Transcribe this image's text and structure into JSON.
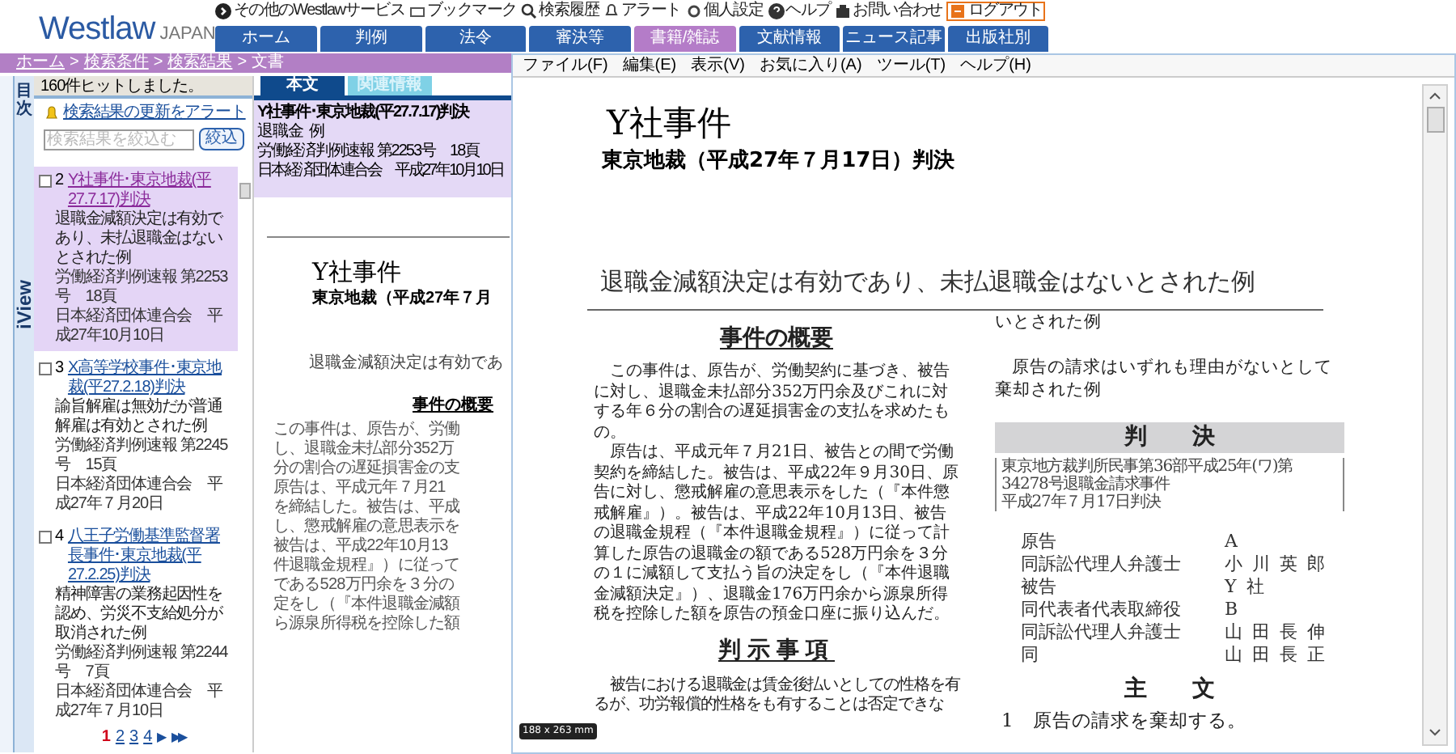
{
  "header": {
    "logo": "Westlaw",
    "logo_suffix": "JAPAN",
    "top_links": [
      {
        "label": "その他のWestlawサービス"
      },
      {
        "label": "ブックマーク"
      },
      {
        "label": "検索履歴"
      },
      {
        "label": "アラート"
      },
      {
        "label": "個人設定"
      },
      {
        "label": "ヘルプ"
      },
      {
        "label": "お問い合わせ"
      },
      {
        "label": "ログアウト"
      }
    ],
    "nav_tabs": [
      {
        "label": "ホーム",
        "selected": false
      },
      {
        "label": "判例",
        "selected": false
      },
      {
        "label": "法令",
        "selected": false
      },
      {
        "label": "審決等",
        "selected": false
      },
      {
        "label": "書籍/雑誌",
        "selected": true
      },
      {
        "label": "文献情報",
        "selected": false
      },
      {
        "label": "ニュース記事",
        "selected": false
      },
      {
        "label": "出版社別",
        "selected": false
      }
    ],
    "breadcrumb": [
      "ホーム",
      "検索条件",
      "検索結果",
      "文書"
    ],
    "breadcrumb_separator": ">"
  },
  "side_rail": {
    "toc_label": "目次",
    "iview_label": "iView"
  },
  "results": {
    "count": "160件ヒットしました。",
    "alert_link": "検索結果の更新をアラート",
    "filter": {
      "placeholder": "検索結果を絞込む",
      "button": "絞込"
    },
    "items": [
      {
        "number": "2",
        "title": "Y社事件･東京地裁(平27.7.17)判決",
        "summary": "退職金減額決定は有効であり、未払退職金はないとされた例",
        "source": "労働経済判例速報 第2253号　18頁",
        "publisher": "日本経済団体連合会　平成27年10月10日",
        "selected": true,
        "checked": false
      },
      {
        "number": "3",
        "title": "X高等学校事件･東京地裁(平27.2.18)判決",
        "summary": "諭旨解雇は無効だが普通解雇は有効とされた例",
        "source": "労働経済判例速報 第2245号　15頁",
        "publisher": "日本経済団体連合会　平成27年７月20日",
        "selected": false,
        "checked": false
      },
      {
        "number": "4",
        "title": "八王子労働基準監督署長事件･東京地裁(平27.2.25)判決",
        "summary": "精神障害の業務起因性を認め、労災不支給処分が取消された例",
        "source": "労働経済判例速報 第2244号　7頁",
        "publisher": "日本経済団体連合会　平成27年７月10日",
        "selected": false,
        "checked": false
      }
    ],
    "pages": [
      {
        "label": "1",
        "selected": true
      },
      {
        "label": "2",
        "selected": false
      },
      {
        "label": "3",
        "selected": false
      },
      {
        "label": "4",
        "selected": false
      }
    ],
    "next": "▶",
    "last": "▶▶"
  },
  "detail": {
    "tabs": [
      {
        "label": "本文",
        "selected": true
      },
      {
        "label": "関連情報",
        "selected": false
      }
    ],
    "info": {
      "title": "Y社事件･東京地裁(平27.7.17)判決",
      "summary": "退職金",
      "summary_cont": "例",
      "source": "労働経済判例速報 第2253号　18頁",
      "publisher": "日本経済団体連合会　平成27年10月10日"
    },
    "preview": {
      "title": "Y社事件",
      "court": "東京地裁（平成27年７月",
      "headline": "退職金減額決定は有効であ",
      "section": "事件の概要",
      "lines": [
        "この事件は、原告が、労働",
        "し、退職金未払部分352万",
        "分の割合の遅延損害金の支",
        "原告は、平成元年７月21",
        "を締結した。被告は、平成",
        "し、懲戒解雇の意思表示を",
        "被告は、平成22年10月13",
        "件退職金規程』）に従って",
        "である528万円余を３分の",
        "定をし（『本件退職金減額",
        "ら源泉所得税を控除した額"
      ]
    }
  },
  "viewer": {
    "menu": [
      "ファイル(F)",
      "編集(E)",
      "表示(V)",
      "お気に入り(A)",
      "ツール(T)",
      "ヘルプ(H)"
    ],
    "title": "Y社事件",
    "court": "東京地裁（平成27年７月17日）判決",
    "headline": "退職金減額決定は有効であり、未払退職金はないとされた例",
    "left": {
      "section": "事件の概要",
      "paragraphs": [
        "この事件は、原告が、労働契約に基づき、被告に対し、退職金未払部分352万円余及びこれに対する年６分の割合の遅延損害金の支払を求めたもの。",
        "原告は、平成元年７月21日、被告との間で労働契約を締結した。被告は、平成22年９月30日、原告に対し、懲戒解雇の意思表示をした（『本件懲戒解雇』）。被告は、平成22年10月13日、被告の退職金規程（『本件退職金規程』）に従って計算した原告の退職金の額である528万円余を３分の１に減額して支払う旨の決定をし（『本件退職金減額決定』）、退職金176万円余から源泉所得税を控除した額を原告の預金口座に振り込んだ。"
      ],
      "section2": "判示事項",
      "lines2": [
        "被告における退職金は賃金後払いとしての性格を有",
        "るが、功労報償的性格をも有することは否定できな"
      ]
    },
    "right": {
      "continued": "いとされた例",
      "paragraph": "原告の請求はいずれも理由がないとして棄却された例",
      "judgment": "判　　決",
      "case_lines": [
        "東京地方裁判所民事第36部平成25年(ワ)第34278号退職金請求事件",
        "平成27年７月17日判決"
      ],
      "parties": [
        {
          "role": "原告",
          "name": "A"
        },
        {
          "role": "同訴訟代理人弁護士",
          "name": "小川英郎"
        },
        {
          "role": "被告",
          "name": "Y社"
        },
        {
          "role": "同代表者代表取締役",
          "name": "B"
        },
        {
          "role": "同訴訟代理人弁護士",
          "name": "山田長伸"
        },
        {
          "role": "同",
          "name": "山田長正"
        }
      ],
      "main": "主　　文",
      "items": [
        "1　原告の請求を棄却する。"
      ]
    },
    "page_size": "188 x 263 mm"
  }
}
